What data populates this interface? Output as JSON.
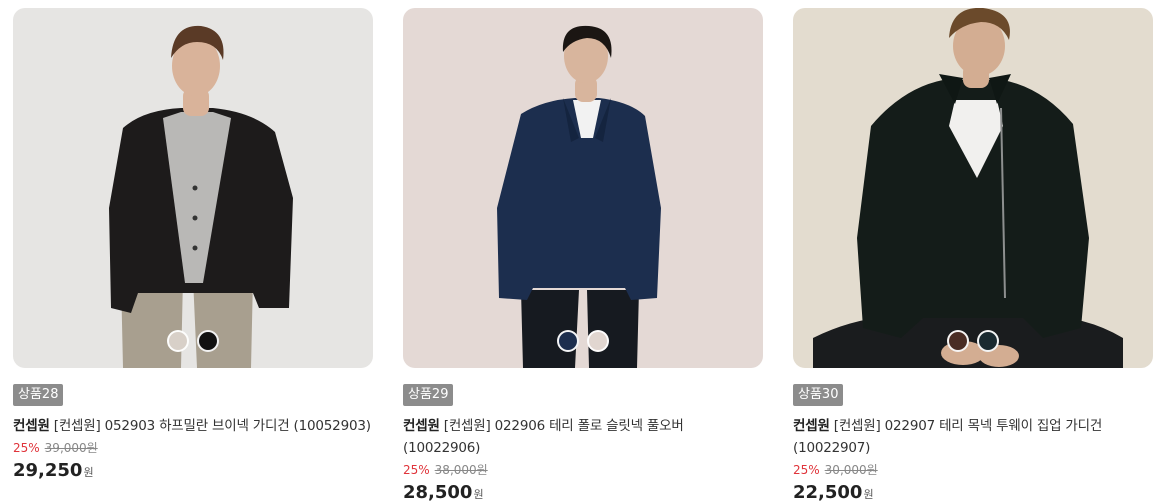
{
  "products": [
    {
      "badge": "상품28",
      "brand": "컨셉원",
      "name": "[컨셉원] 052903 하프밀란 브이넥 가디건 (10052903)",
      "discount": "25%",
      "original_price": "39,000원",
      "price": "29,250",
      "currency": "원",
      "image": {
        "background": "#e6e5e3",
        "garment": "#1d1b1b",
        "inner": "#b9b8b6",
        "pants": "#a89f8f",
        "skin": "#d9b39a",
        "hair": "#5a3a26",
        "subject": "model-wearing-black-v-neck-cardigan"
      },
      "swatches": [
        "#d8d0c8",
        "#111111"
      ]
    },
    {
      "badge": "상품29",
      "brand": "컨셉원",
      "name": "[컨셉원] 022906 테리 폴로 슬릿넥 풀오버 (10022906)",
      "discount": "25%",
      "original_price": "38,000원",
      "price": "28,500",
      "currency": "원",
      "image": {
        "background": "#e4d9d5",
        "garment": "#1c2e4e",
        "inner": "#f2f2f2",
        "pants": "#161a20",
        "skin": "#d8b59d",
        "hair": "#1b1613",
        "subject": "model-wearing-navy-polo-pullover"
      },
      "swatches": [
        "#1c2e4e",
        "#e1d6d0"
      ]
    },
    {
      "badge": "상품30",
      "brand": "컨셉원",
      "name": "[컨셉원] 022907 테리 목넥 투웨이 집업 가디건 (10022907)",
      "discount": "25%",
      "original_price": "30,000원",
      "price": "22,500",
      "currency": "원",
      "image": {
        "background": "#e3dccf",
        "garment": "#141c19",
        "inner": "#f1f0ee",
        "pants": "#1a1c1e",
        "skin": "#d3ad92",
        "hair": "#6b4a2b",
        "subject": "model-wearing-black-zip-up-cardigan"
      },
      "swatches": [
        "#4a2d24",
        "#1a2a30"
      ]
    }
  ]
}
